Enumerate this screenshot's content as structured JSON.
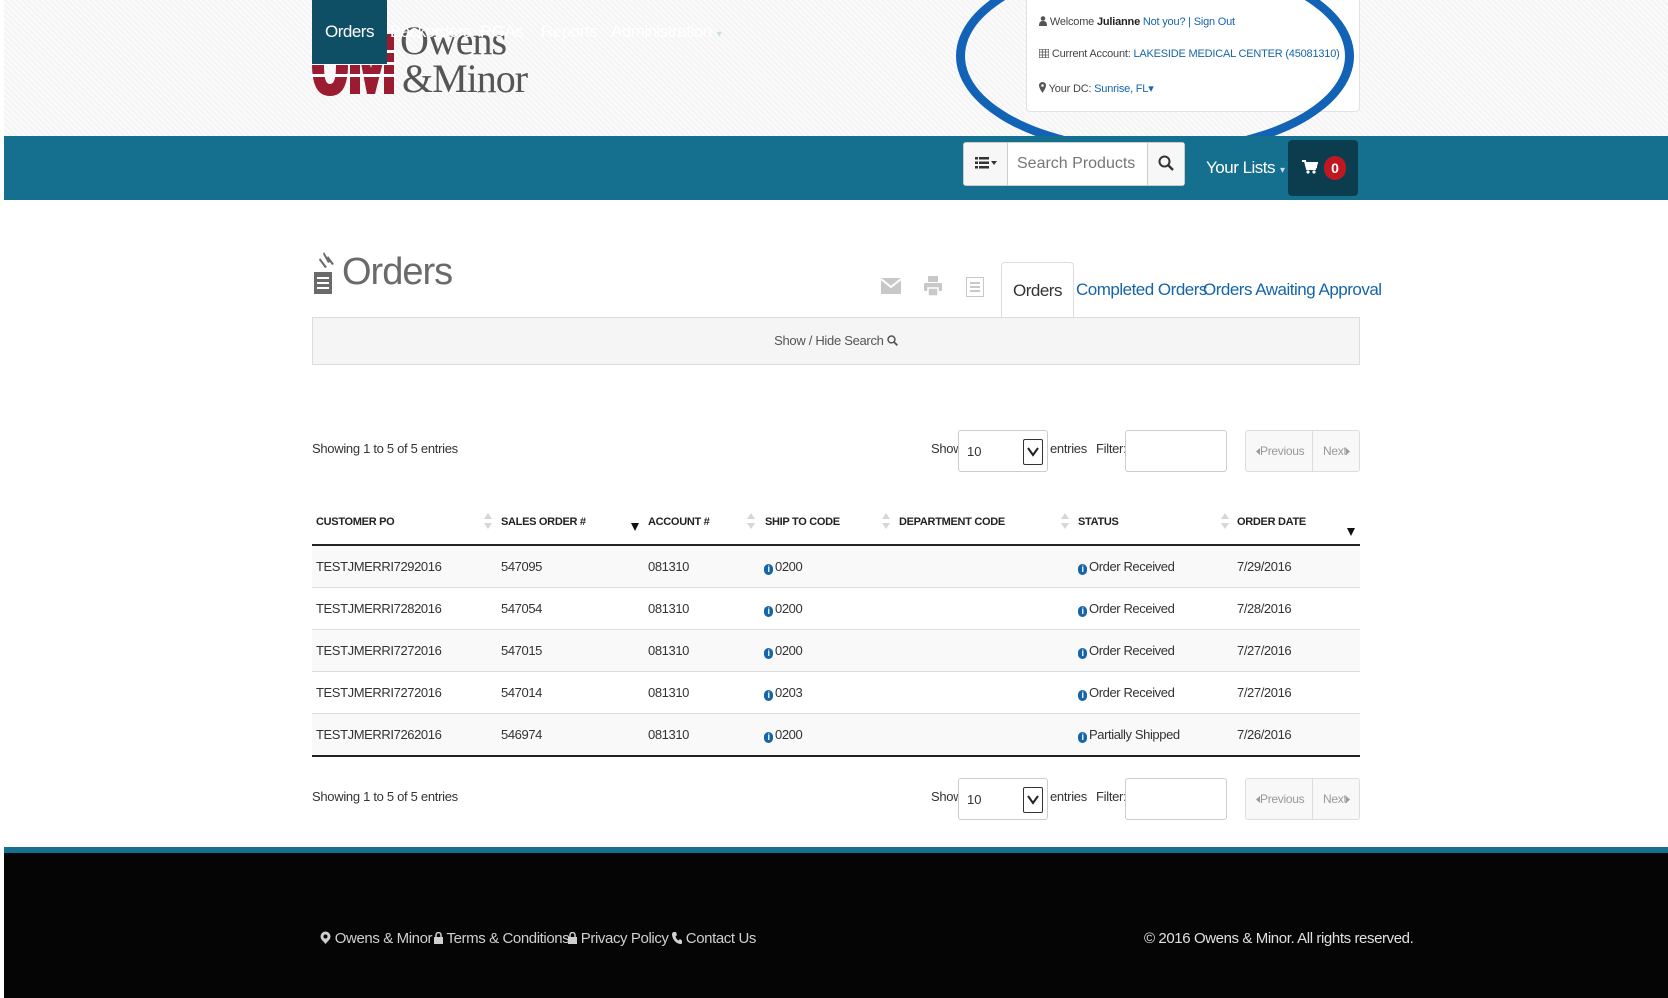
{
  "brand": {
    "logo_mark": "OM",
    "logo_line1": "Owens",
    "logo_line2": "&Minor",
    "logo_colors": {
      "mark": "#9b1b30",
      "text": "#555555"
    }
  },
  "account": {
    "welcome_prefix": "Welcome",
    "user_name": "Julianne",
    "not_you": "Not you?",
    "separator": "|",
    "sign_out": "Sign Out",
    "current_account_label": "Current Account:",
    "current_account_value": "LAKESIDE MEDICAL CENTER (45081310)",
    "dc_label": "Your DC:",
    "dc_value": "Sunrise, FL",
    "dc_caret": "▾"
  },
  "nav": {
    "items": [
      {
        "label": "Orders",
        "active": true
      },
      {
        "label": "Backorders"
      },
      {
        "label": "RGAs"
      },
      {
        "label": "Reports"
      },
      {
        "label": "Administration",
        "caret": "▾"
      }
    ],
    "search_placeholder": "Search Products",
    "your_lists": "Your Lists",
    "your_lists_caret": "▾",
    "cart_count": "0"
  },
  "page": {
    "title": "Orders",
    "toolbar_icons": [
      "email-icon",
      "print-icon",
      "list-icon"
    ],
    "tabs": [
      {
        "label": "Orders",
        "active": true
      },
      {
        "label": "Completed Orders"
      },
      {
        "label": "Orders Awaiting Approval"
      }
    ],
    "search_toggle": "Show / Hide Search"
  },
  "table_controls": {
    "showing": "Showing 1 to 5 of 5 entries",
    "show_label": "Show",
    "page_length": "10",
    "entries_label": "entries",
    "filter_label": "Filter:",
    "filter_value": "",
    "prev": "Previous",
    "next": "Next"
  },
  "table": {
    "columns": [
      "CUSTOMER PO",
      "SALES ORDER #",
      "ACCOUNT #",
      "SHIP TO CODE",
      "DEPARTMENT CODE",
      "STATUS",
      "ORDER DATE"
    ],
    "rows": [
      {
        "customer_po": "TESTJMERRI7292016",
        "sales_order": "547095",
        "account": "081310",
        "ship_to": "0200",
        "department": "",
        "status": "Order Received",
        "order_date": "7/29/2016"
      },
      {
        "customer_po": "TESTJMERRI7282016",
        "sales_order": "547054",
        "account": "081310",
        "ship_to": "0200",
        "department": "",
        "status": "Order Received",
        "order_date": "7/28/2016"
      },
      {
        "customer_po": "TESTJMERRI7272016",
        "sales_order": "547015",
        "account": "081310",
        "ship_to": "0200",
        "department": "",
        "status": "Order Received",
        "order_date": "7/27/2016"
      },
      {
        "customer_po": "TESTJMERRI7272016",
        "sales_order": "547014",
        "account": "081310",
        "ship_to": "0203",
        "department": "",
        "status": "Order Received",
        "order_date": "7/27/2016"
      },
      {
        "customer_po": "TESTJMERRI7262016",
        "sales_order": "546974",
        "account": "081310",
        "ship_to": "0200",
        "department": "",
        "status": "Partially Shipped",
        "order_date": "7/26/2016"
      }
    ]
  },
  "footer": {
    "links": [
      {
        "label": "Owens & Minor",
        "icon": "location-pin-icon"
      },
      {
        "label": "Terms & Conditions",
        "icon": "lock-icon"
      },
      {
        "label": "Privacy Policy",
        "icon": "lock-icon"
      },
      {
        "label": "Contact Us",
        "icon": "phone-icon"
      }
    ],
    "copyright": "© 2016 Owens & Minor. All rights reserved."
  },
  "colors": {
    "nav_bg": "#156f8e",
    "nav_active": "#0e4f66",
    "link": "#1565a8",
    "annotation_ring": "#1262b5",
    "cart_badge": "#c01820",
    "footer_bg": "#050505"
  }
}
